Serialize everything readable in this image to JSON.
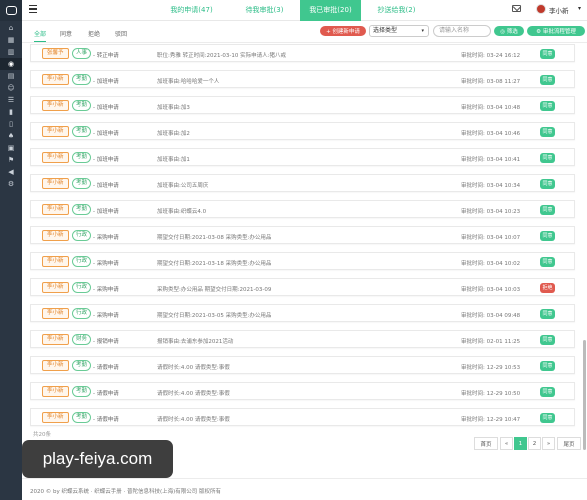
{
  "sidebar": {
    "icons": [
      "dashboard-icon",
      "grid-icon",
      "chart-icon",
      "approval-icon",
      "calendar-icon",
      "users-icon",
      "list-icon",
      "book-icon",
      "document-icon",
      "lightbulb-icon",
      "image-icon",
      "flag-icon",
      "megaphone-icon",
      "settings-icon"
    ],
    "glyphs": [
      "⌂",
      "▦",
      "▥",
      "◉",
      "▤",
      "☺",
      "☰",
      "▮",
      "▯",
      "♠",
      "▣",
      "⚑",
      "◀",
      "⚙"
    ]
  },
  "header": {
    "tabs": [
      {
        "label": "我的申请(47)"
      },
      {
        "label": "待我审批(3)"
      },
      {
        "label": "我已审批(20)"
      },
      {
        "label": "抄送给我(2)"
      }
    ],
    "username": "李小新",
    "caret": "▾"
  },
  "toolbar": {
    "filters": [
      {
        "label": "全部"
      },
      {
        "label": "同意"
      },
      {
        "label": "拒绝"
      },
      {
        "label": "驳回"
      }
    ],
    "create_label": "+ 创建新申请",
    "select_value": "选择类型",
    "select_caret": "▾",
    "search_placeholder": "请输入名称",
    "filter_label": "◎ 筛选",
    "manage_label": "⚙ 审批流程管理"
  },
  "rows": [
    {
      "name": "张馨予",
      "category": "人事",
      "type": "- 转正申请",
      "detail": "职位:秀雅 转正时间:2021-03-10 实际申请人:猪八戒",
      "time": "审批时间: 03-24 16:12",
      "status": "同意",
      "reject": false
    },
    {
      "name": "李小新",
      "category": "考勤",
      "type": "- 加班申请",
      "detail": "加班事由:哈哈哈爱一个人",
      "time": "审批时间: 03-08 11:27",
      "status": "同意",
      "reject": false
    },
    {
      "name": "李小新",
      "category": "考勤",
      "type": "- 加班申请",
      "detail": "加班事由:加3",
      "time": "审批时间: 03-04 10:48",
      "status": "同意",
      "reject": false
    },
    {
      "name": "李小新",
      "category": "考勤",
      "type": "- 加班申请",
      "detail": "加班事由:加2",
      "time": "审批时间: 03-04 10:46",
      "status": "同意",
      "reject": false
    },
    {
      "name": "李小新",
      "category": "考勤",
      "type": "- 加班申请",
      "detail": "加班事由:加1",
      "time": "审批时间: 03-04 10:41",
      "status": "同意",
      "reject": false
    },
    {
      "name": "李小新",
      "category": "考勤",
      "type": "- 加班申请",
      "detail": "加班事由:公司五周庆",
      "time": "审批时间: 03-04 10:34",
      "status": "同意",
      "reject": false
    },
    {
      "name": "李小新",
      "category": "考勤",
      "type": "- 加班申请",
      "detail": "加班事由:织蝶云4.0",
      "time": "审批时间: 03-04 10:23",
      "status": "同意",
      "reject": false
    },
    {
      "name": "李小新",
      "category": "行政",
      "type": "- 采购申请",
      "detail": "期望交付日期:2021-03-08 采购类型:办公用品",
      "time": "审批时间: 03-04 10:07",
      "status": "同意",
      "reject": false
    },
    {
      "name": "李小新",
      "category": "行政",
      "type": "- 采购申请",
      "detail": "期望交付日期:2021-03-18 采购类型:办公用品",
      "time": "审批时间: 03-04 10:02",
      "status": "同意",
      "reject": false
    },
    {
      "name": "李小新",
      "category": "行政",
      "type": "- 采购申请",
      "detail": "采购类型:办公用品 期望交付日期:2021-03-09",
      "time": "审批时间: 03-04 10:03",
      "status": "拒绝",
      "reject": true
    },
    {
      "name": "李小新",
      "category": "行政",
      "type": "- 采购申请",
      "detail": "期望交付日期:2021-03-05 采购类型:办公用品",
      "time": "审批时间: 03-04 09:48",
      "status": "同意",
      "reject": false
    },
    {
      "name": "李小新",
      "category": "财务",
      "type": "- 报销申请",
      "detail": "报销事由:去浦东参加2021活动",
      "time": "审批时间: 02-01 11:25",
      "status": "同意",
      "reject": false
    },
    {
      "name": "李小新",
      "category": "考勤",
      "type": "- 请假申请",
      "detail": "请假时长:4.00 请假类型:事假",
      "time": "审批时间: 12-29 10:53",
      "status": "同意",
      "reject": false
    },
    {
      "name": "李小新",
      "category": "考勤",
      "type": "- 请假申请",
      "detail": "请假时长:4.00 请假类型:事假",
      "time": "审批时间: 12-29 10:50",
      "status": "同意",
      "reject": false
    },
    {
      "name": "李小新",
      "category": "考勤",
      "type": "- 请假申请",
      "detail": "请假时长:4.00 请假类型:事假",
      "time": "审批时间: 12-29 10:47",
      "status": "同意",
      "reject": false
    }
  ],
  "pagination": {
    "total": "共20条",
    "first": "首页",
    "prev": "«",
    "pages": [
      "1",
      "2"
    ],
    "next": "»",
    "last": "尾页"
  },
  "footer": {
    "text": "2020 © by 织蝶云系统 · 织蝶云手册 · 普陀信息科技(上海)有限公司 版权所有"
  },
  "watermark": "play-feiya.com",
  "colors": {
    "accent": "#40c78f",
    "danger": "#e05a4f",
    "sidebar": "#2b3643"
  }
}
